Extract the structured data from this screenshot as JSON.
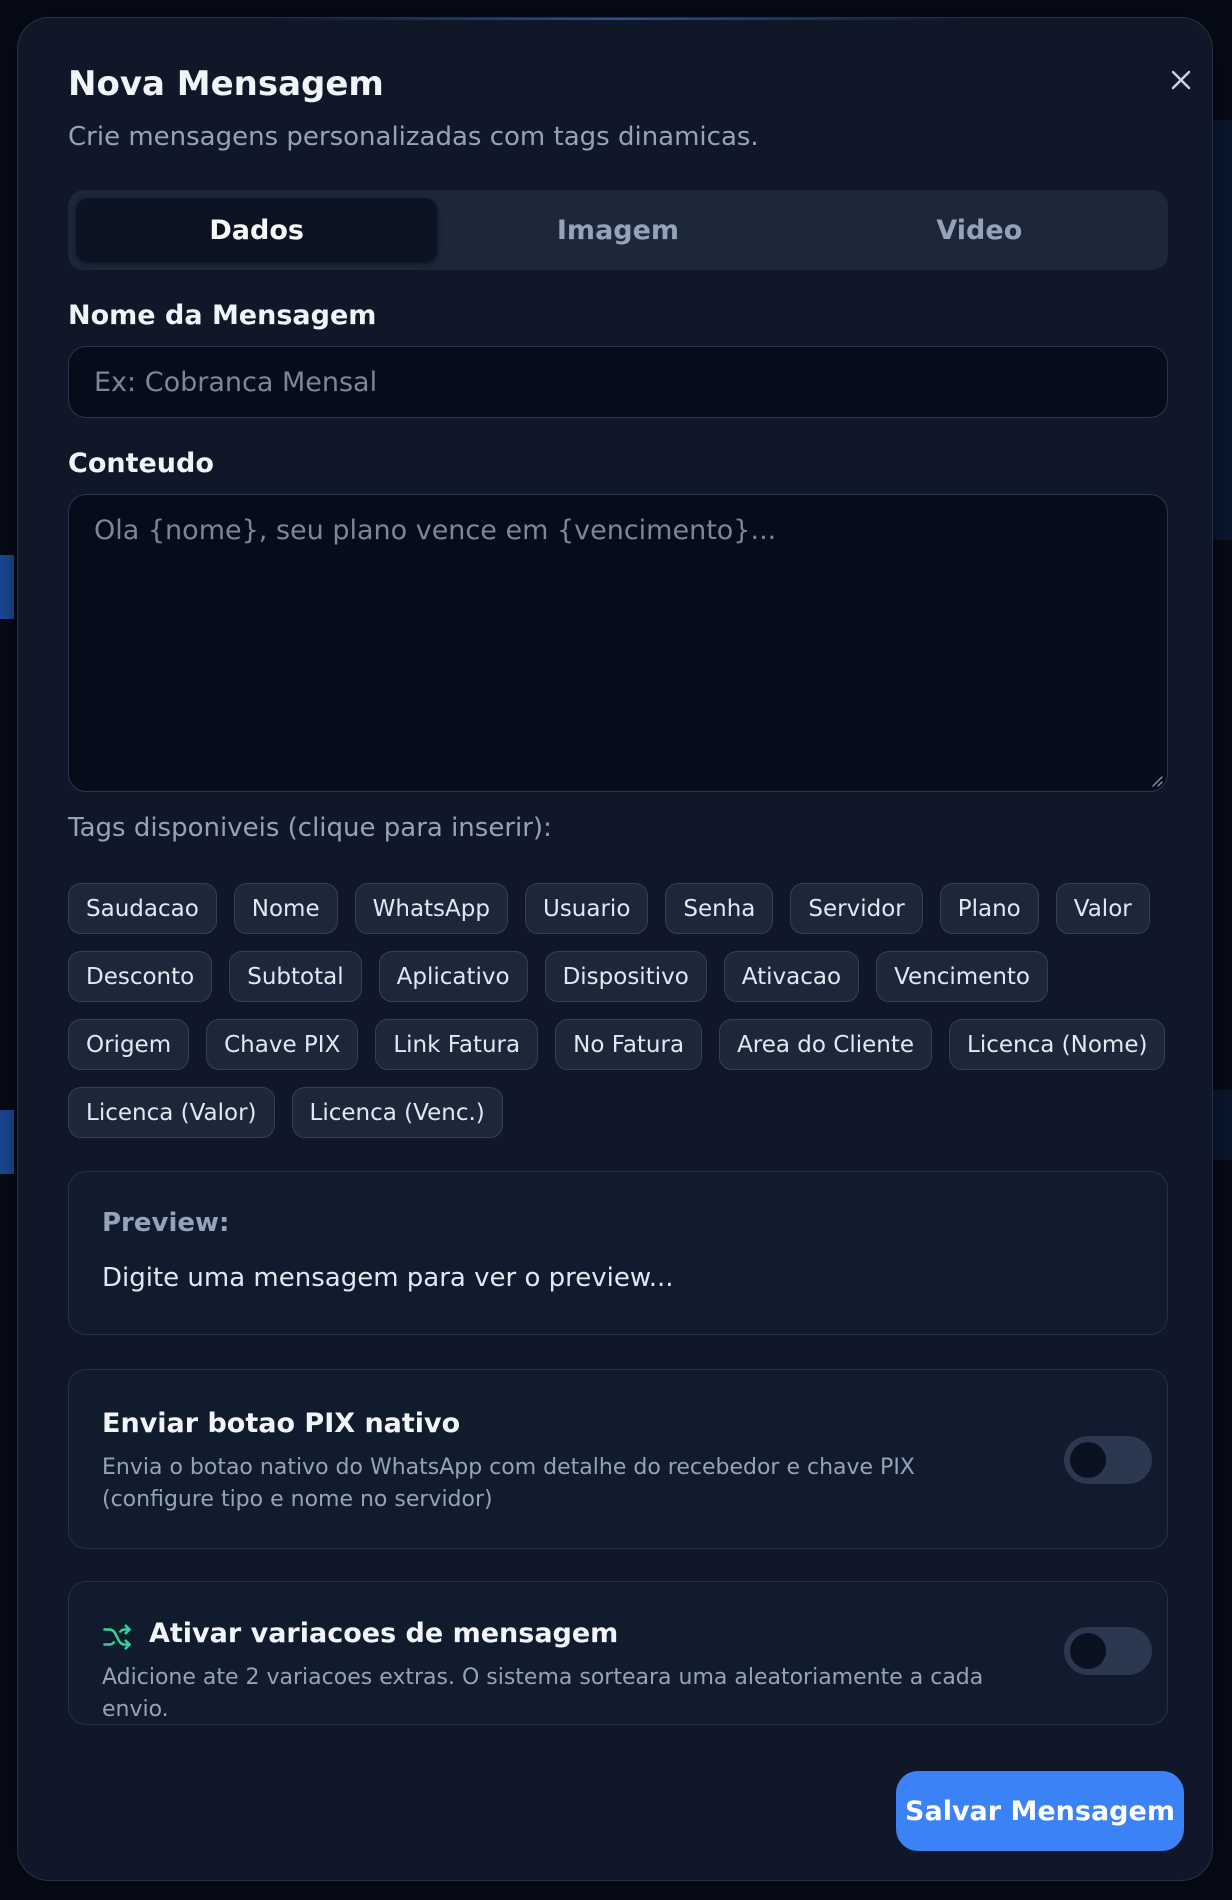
{
  "modal": {
    "title": "Nova Mensagem",
    "subtitle": "Crie mensagens personalizadas com tags dinamicas."
  },
  "tabs": [
    {
      "label": "Dados",
      "active": true
    },
    {
      "label": "Imagem",
      "active": false
    },
    {
      "label": "Video",
      "active": false
    }
  ],
  "form": {
    "name_label": "Nome da Mensagem",
    "name_value": "",
    "name_placeholder": "Ex: Cobranca Mensal",
    "content_label": "Conteudo",
    "content_value": "",
    "content_placeholder": "Ola {nome}, seu plano vence em {vencimento}..."
  },
  "tags": {
    "label": "Tags disponiveis (clique para inserir):",
    "items": [
      "Saudacao",
      "Nome",
      "WhatsApp",
      "Usuario",
      "Senha",
      "Servidor",
      "Plano",
      "Valor",
      "Desconto",
      "Subtotal",
      "Aplicativo",
      "Dispositivo",
      "Ativacao",
      "Vencimento",
      "Origem",
      "Chave PIX",
      "Link Fatura",
      "No Fatura",
      "Area do Cliente",
      "Licenca (Nome)",
      "Licenca (Valor)",
      "Licenca (Venc.)"
    ]
  },
  "preview": {
    "label": "Preview:",
    "text": "Digite uma mensagem para ver o preview..."
  },
  "pix_option": {
    "title": "Enviar botao PIX nativo",
    "description": "Envia o botao nativo do WhatsApp com detalhe do recebedor e chave PIX (configure tipo e nome no servidor)",
    "enabled": false
  },
  "variations_option": {
    "icon": "shuffle-icon",
    "title": "Ativar variacoes de mensagem",
    "description": "Adicione ate 2 variacoes extras. O sistema sorteara uma aleatoriamente a cada envio.",
    "enabled": false
  },
  "actions": {
    "save_label": "Salvar Mensagem"
  },
  "colors": {
    "accent": "#3b82f6",
    "icon_green": "#34d399",
    "surface": "#0f1729",
    "input_bg": "#070c1a"
  }
}
